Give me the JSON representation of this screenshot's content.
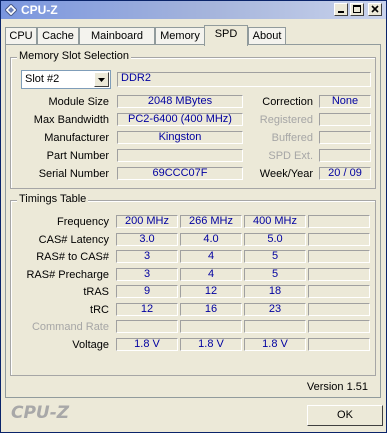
{
  "window": {
    "title": "CPU-Z"
  },
  "tabs": [
    "CPU",
    "Cache",
    "Mainboard",
    "Memory",
    "SPD",
    "About"
  ],
  "active_tab": "SPD",
  "memory_slot": {
    "title": "Memory Slot Selection",
    "slot_value": "Slot #2",
    "module_type": "DDR2",
    "module_size_label": "Module Size",
    "module_size": "2048 MBytes",
    "max_bandwidth_label": "Max Bandwidth",
    "max_bandwidth": "PC2-6400 (400 MHz)",
    "manufacturer_label": "Manufacturer",
    "manufacturer": "Kingston",
    "part_number_label": "Part Number",
    "part_number": "",
    "serial_number_label": "Serial Number",
    "serial_number": "69CCC07F",
    "correction_label": "Correction",
    "correction": "None",
    "registered_label": "Registered",
    "registered": "",
    "buffered_label": "Buffered",
    "buffered": "",
    "spd_ext_label": "SPD Ext.",
    "spd_ext": "",
    "week_year_label": "Week/Year",
    "week_year": "20 / 09"
  },
  "timings": {
    "title": "Timings Table",
    "rows": [
      {
        "label": "Frequency",
        "values": [
          "200 MHz",
          "266 MHz",
          "400 MHz",
          ""
        ],
        "disabled": false
      },
      {
        "label": "CAS# Latency",
        "values": [
          "3.0",
          "4.0",
          "5.0",
          ""
        ],
        "disabled": false
      },
      {
        "label": "RAS# to CAS#",
        "values": [
          "3",
          "4",
          "5",
          ""
        ],
        "disabled": false
      },
      {
        "label": "RAS# Precharge",
        "values": [
          "3",
          "4",
          "5",
          ""
        ],
        "disabled": false
      },
      {
        "label": "tRAS",
        "values": [
          "9",
          "12",
          "18",
          ""
        ],
        "disabled": false
      },
      {
        "label": "tRC",
        "values": [
          "12",
          "16",
          "23",
          ""
        ],
        "disabled": false
      },
      {
        "label": "Command Rate",
        "values": [
          "",
          "",
          "",
          ""
        ],
        "disabled": true
      },
      {
        "label": "Voltage",
        "values": [
          "1.8 V",
          "1.8 V",
          "1.8 V",
          ""
        ],
        "disabled": false
      }
    ]
  },
  "version": "Version 1.51",
  "brand": "CPU-Z",
  "ok_label": "OK"
}
